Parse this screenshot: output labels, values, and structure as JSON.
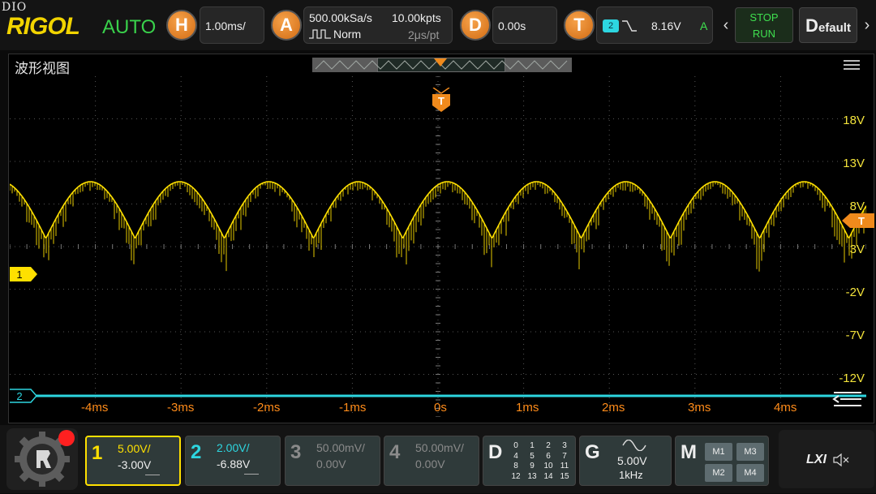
{
  "top": {
    "dio": "DIO",
    "brand": "RIGOL",
    "mode": "AUTO",
    "horizontal": {
      "badge": "H",
      "scale": "1.00ms/"
    },
    "acquire": {
      "badge": "A",
      "sample_rate": "500.00kSa/s",
      "points": "10.00kpts",
      "mode": "Norm",
      "time_per_point": "2μs/pt"
    },
    "delay": {
      "badge": "D",
      "value": "0.00s"
    },
    "trigger": {
      "badge": "T",
      "source": "2",
      "level": "8.16V",
      "sweep": "A"
    },
    "stop_label": "STOP",
    "run_label": "RUN",
    "default_label_first": "D",
    "default_label_rest": "efault"
  },
  "wave": {
    "title": "波形视图",
    "trigger_marker": "T",
    "ch1_marker": "1",
    "ch2_marker": "2",
    "volt_labels": [
      "18V",
      "13V",
      "8V",
      "3V",
      "-2V",
      "-7V",
      "-12V"
    ],
    "time_labels": [
      "-4ms",
      "-3ms",
      "-2ms",
      "-1ms",
      "0s",
      "1ms",
      "2ms",
      "3ms",
      "4ms"
    ]
  },
  "channels": [
    {
      "num": "1",
      "scale": "5.00V/",
      "offset": "-3.00V",
      "color": "#ffe000",
      "active": true
    },
    {
      "num": "2",
      "scale": "2.00V/",
      "offset": "-6.88V",
      "color": "#2dd6e0",
      "active": true
    },
    {
      "num": "3",
      "scale": "50.00mV/",
      "offset": "0.00V",
      "color": "#8a8a8a",
      "active": false
    },
    {
      "num": "4",
      "scale": "50.00mV/",
      "offset": "0.00V",
      "color": "#8a8a8a",
      "active": false
    }
  ],
  "digital": {
    "label": "D",
    "rows": [
      [
        "0",
        "1",
        "2",
        "3"
      ],
      [
        "4",
        "5",
        "6",
        "7"
      ],
      [
        "8",
        "9",
        "10",
        "11"
      ],
      [
        "12",
        "13",
        "14",
        "15"
      ]
    ]
  },
  "generator": {
    "label": "G",
    "amplitude": "5.00V",
    "frequency": "1kHz"
  },
  "math": {
    "label": "M",
    "buttons": [
      "M1",
      "M3",
      "M2",
      "M4"
    ]
  },
  "lxi": {
    "label": "LXI"
  },
  "colors": {
    "ch1": "#ffe000",
    "ch2": "#2dd6e0",
    "accent": "#f08a1c",
    "grid": "#555555"
  }
}
